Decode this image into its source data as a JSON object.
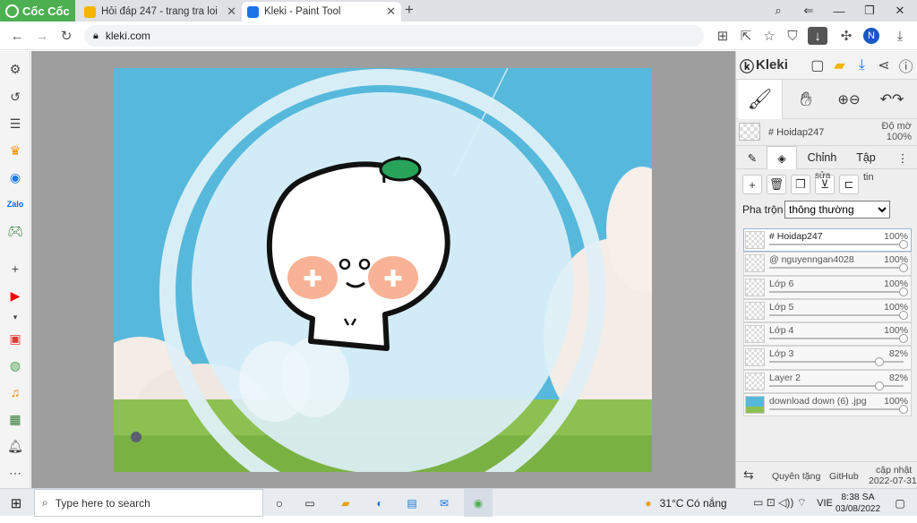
{
  "browser": {
    "brand": "Cốc Cốc",
    "tabs": [
      {
        "title": "Hỏi đáp 247 - trang tra loi",
        "favicon_color": "#f4b400"
      },
      {
        "title": "Kleki - Paint Tool",
        "favicon_color": "#1a73e8"
      }
    ],
    "new_tab": "+",
    "url": "kleki.com",
    "profile_initial": "N"
  },
  "kleki": {
    "logo": "Kleki",
    "layer_name_display": "# Hoidap247",
    "opacity_label": "Độ mờ",
    "opacity_value": "100%",
    "tabs": [
      "Chỉnh",
      "Tập"
    ],
    "action_label_1": "sửa",
    "action_label_2": "tin",
    "blend_label": "Pha trộn",
    "blend_value": "thông thường",
    "layers": [
      {
        "name": "# Hoidap247",
        "opacity": "100%",
        "level": 1.0
      },
      {
        "name": "@ nguyenngan4028",
        "opacity": "100%",
        "level": 1.0
      },
      {
        "name": "Lớp 6",
        "opacity": "100%",
        "level": 1.0
      },
      {
        "name": "Lớp 5",
        "opacity": "100%",
        "level": 1.0
      },
      {
        "name": "Lớp 4",
        "opacity": "100%",
        "level": 1.0
      },
      {
        "name": "Lớp 3",
        "opacity": "82%",
        "level": 0.82
      },
      {
        "name": "Layer 2",
        "opacity": "82%",
        "level": 0.82
      },
      {
        "name": "download down (6) .jpg",
        "opacity": "100%",
        "level": 1.0
      }
    ],
    "footer": {
      "theme_link": "Quyên tặng",
      "github_link": "GitHub",
      "update_label": "cập nhật",
      "update_date": "2022-07-31"
    }
  },
  "taskbar": {
    "search_placeholder": "Type here to search",
    "weather_temp": "31°C",
    "weather_desc": "Có nắng",
    "language": "VIE",
    "time": "8:38 SA",
    "date": "03/08/2022"
  },
  "colors": {
    "sky": "#56b9dc",
    "grass": "#8cc152",
    "accent_green": "#4caf50",
    "kleki_blue": "#1a73e8"
  }
}
